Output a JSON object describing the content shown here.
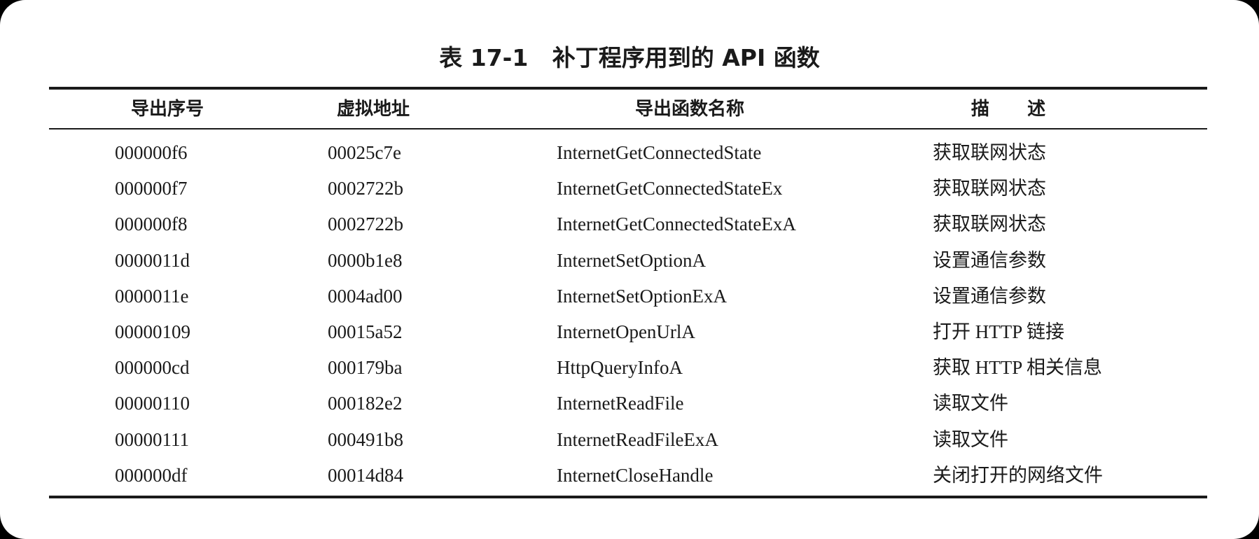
{
  "table": {
    "title": "表 17-1   补丁程序用到的 API 函数",
    "headers": {
      "ordinal": "导出序号",
      "address": "虚拟地址",
      "function": "导出函数名称",
      "description": "描      述"
    },
    "rows": [
      {
        "ordinal": "000000f6",
        "address": "00025c7e",
        "function": "InternetGetConnectedState",
        "description": "获取联网状态"
      },
      {
        "ordinal": "000000f7",
        "address": "0002722b",
        "function": "InternetGetConnectedStateEx",
        "description": "获取联网状态"
      },
      {
        "ordinal": "000000f8",
        "address": "0002722b",
        "function": "InternetGetConnectedStateExA",
        "description": "获取联网状态"
      },
      {
        "ordinal": "0000011d",
        "address": "0000b1e8",
        "function": "InternetSetOptionA",
        "description": "设置通信参数"
      },
      {
        "ordinal": "0000011e",
        "address": "0004ad00",
        "function": "InternetSetOptionExA",
        "description": "设置通信参数"
      },
      {
        "ordinal": "00000109",
        "address": "00015a52",
        "function": "InternetOpenUrlA",
        "description": "打开 HTTP 链接"
      },
      {
        "ordinal": "000000cd",
        "address": "000179ba",
        "function": "HttpQueryInfoA",
        "description": "获取 HTTP 相关信息"
      },
      {
        "ordinal": "00000110",
        "address": "000182e2",
        "function": "InternetReadFile",
        "description": "读取文件"
      },
      {
        "ordinal": "00000111",
        "address": "000491b8",
        "function": "InternetReadFileExA",
        "description": "读取文件"
      },
      {
        "ordinal": "000000df",
        "address": "00014d84",
        "function": "InternetCloseHandle",
        "description": "关闭打开的网络文件"
      }
    ]
  }
}
